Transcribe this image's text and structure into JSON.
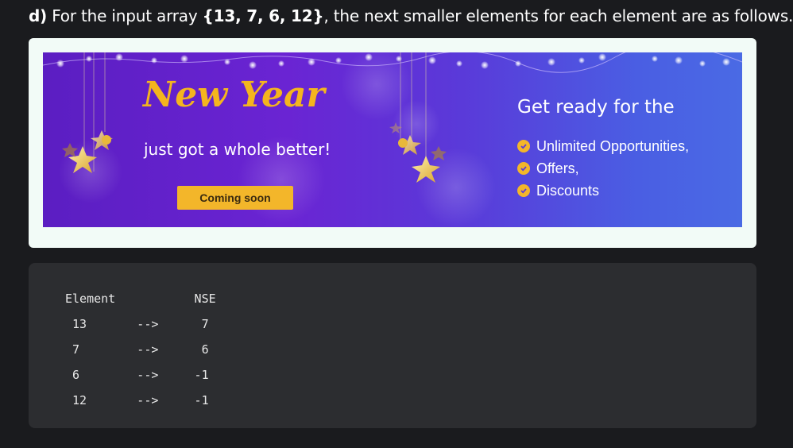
{
  "heading": {
    "prefix": "d)",
    "text_before": " For the input array ",
    "array": "{13, 7, 6, 12}",
    "text_after": ", the next smaller elements for each element are as follows."
  },
  "ad": {
    "title": "New Year",
    "subtitle": "just got a whole better!",
    "cta_label": "Coming soon",
    "ready_text": "Get ready for the",
    "features": [
      "Unlimited Opportunities,",
      "Offers,",
      "Discounts"
    ],
    "colors": {
      "accent": "#f3b62a",
      "banner_start": "#5b1ec2",
      "banner_end": "#4a6ae4"
    }
  },
  "code": {
    "lines": [
      "Element           NSE",
      " 13       -->      7",
      " 7        -->      6",
      " 6        -->     -1",
      " 12       -->     -1"
    ]
  }
}
